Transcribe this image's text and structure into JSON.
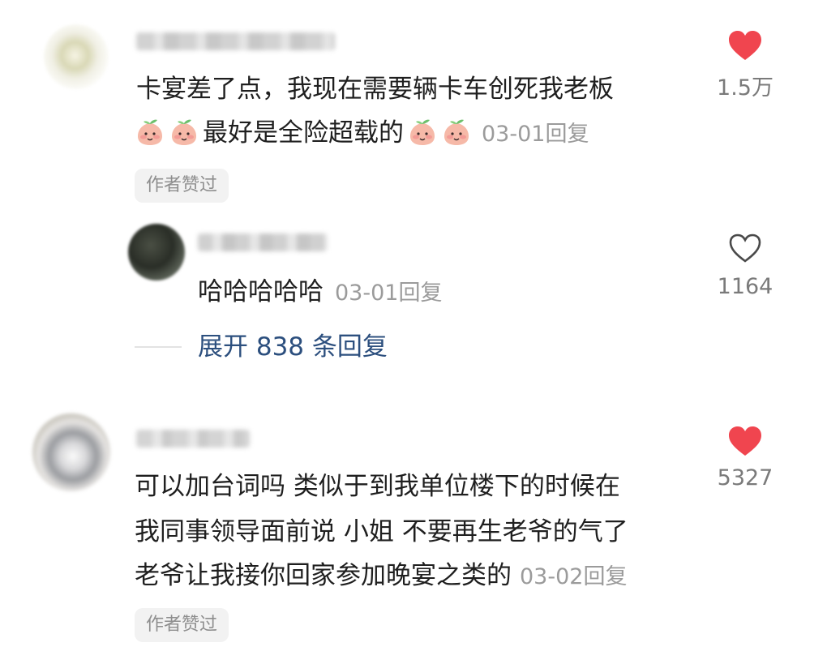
{
  "comments": [
    {
      "text_line1": "卡宴差了点，我现在需要辆卡车创死我老板",
      "text_line2": "最好是全险超载的",
      "date": "03-01",
      "reply_label": "回复",
      "badge": "作者赞过",
      "like_count": "1.5万",
      "liked": true,
      "emoji": "peach-face-emoji"
    },
    {
      "text": "可以加台词吗 类似于到我单位楼下的时候在",
      "text_line2": "我同事领导面前说 小姐 不要再生老爷的气了",
      "text_line3": "老爷让我接你回家参加晚宴之类的",
      "date": "03-02",
      "reply_label": "回复",
      "badge": "作者赞过",
      "like_count": "5327",
      "liked": true
    }
  ],
  "reply": {
    "text": "哈哈哈哈哈",
    "date": "03-01",
    "reply_label": "回复",
    "like_count": "1164",
    "liked": false
  },
  "expand_replies": "展开 838 条回复",
  "colors": {
    "heart_liked": "#f0454f",
    "heart_outline": "#4a4a4a",
    "link": "#2c4f7e",
    "meta": "#9b9b9b"
  }
}
